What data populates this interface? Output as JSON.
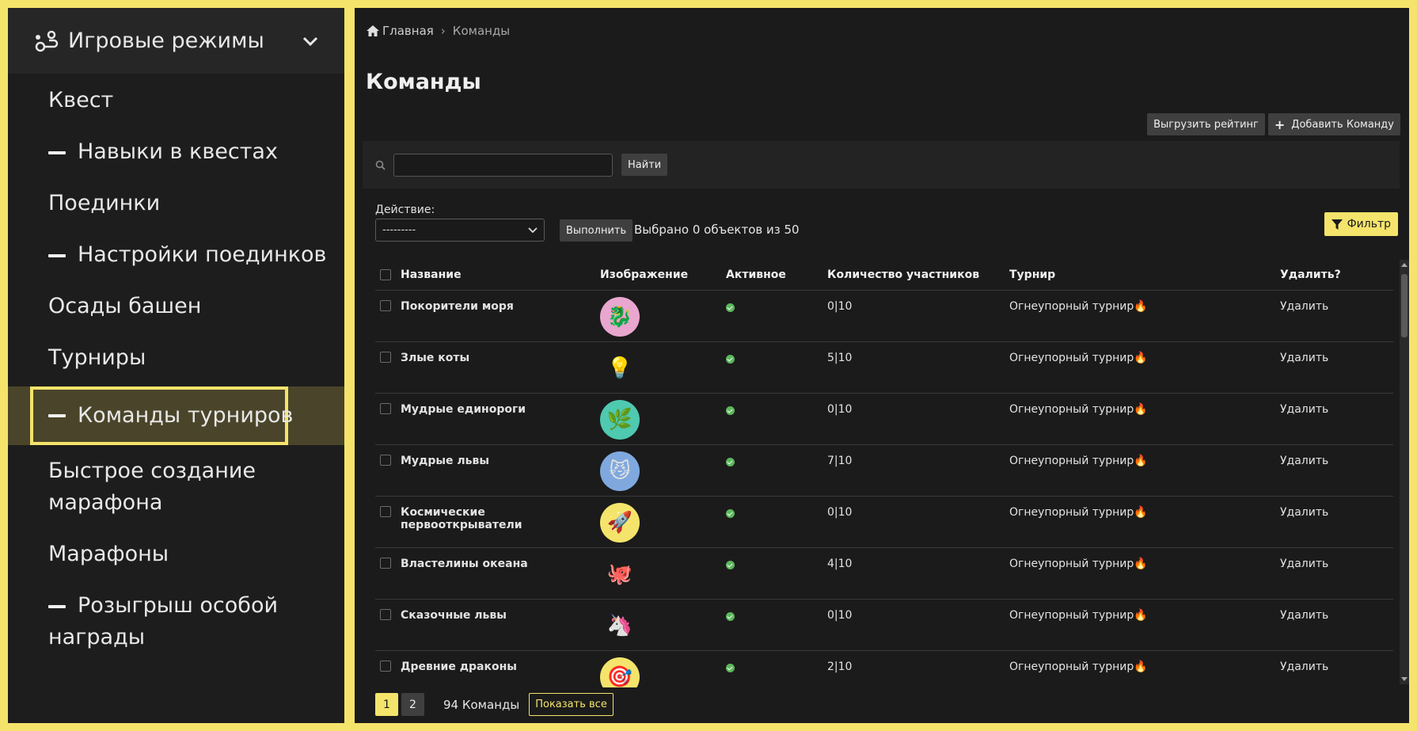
{
  "sidebar": {
    "header_title": "Игровые режимы",
    "items": [
      {
        "label": "Квест",
        "sub": false
      },
      {
        "label": "Навыки в квестах",
        "sub": true
      },
      {
        "label": "Поединки",
        "sub": false
      },
      {
        "label": "Настройки поединков",
        "sub": true
      },
      {
        "label": "Осады башен",
        "sub": false
      },
      {
        "label": "Турниры",
        "sub": false
      },
      {
        "label": "Команды турниров",
        "sub": true,
        "active": true
      },
      {
        "label": "Быстрое создание марафона",
        "label_line1": "Быстрое создание",
        "label_line2": "марафона",
        "sub": false
      },
      {
        "label": "Марафоны",
        "sub": false
      },
      {
        "label": "Розыгрыш особой награды",
        "label_line1": "Розыгрыш особой",
        "label_line2": "награды",
        "sub": true
      }
    ]
  },
  "breadcrumb": {
    "home": "Главная",
    "separator": "›",
    "current": "Команды"
  },
  "page_title": "Команды",
  "toolbar": {
    "export_label": "Выгрузить рейтинг",
    "add_label": "Добавить Команду"
  },
  "search": {
    "value": "",
    "button": "Найти"
  },
  "actions": {
    "label": "Действие:",
    "selected": "---------",
    "run_button": "Выполнить",
    "selected_info": "Выбрано 0 объектов из 50"
  },
  "filter_label": "Фильтр",
  "table": {
    "headers": [
      "Название",
      "Изображение",
      "Активное",
      "Количество участников",
      "Турнир",
      "Удалить?"
    ],
    "rows": [
      {
        "name": "Покорители моря",
        "emoji": "🐉",
        "bg": "#e9a6cf",
        "count": "0|10",
        "tournament": "Огнеупорный турнир🔥",
        "delete": "Удалить"
      },
      {
        "name": "Злые коты",
        "emoji": "💡",
        "bg": "transparent",
        "count": "5|10",
        "tournament": "Огнеупорный турнир🔥",
        "delete": "Удалить"
      },
      {
        "name": "Мудрые единороги",
        "emoji": "🌿",
        "bg": "#4fc9b0",
        "count": "0|10",
        "tournament": "Огнеупорный турнир🔥",
        "delete": "Удалить"
      },
      {
        "name": "Мудрые львы",
        "emoji": "😼",
        "bg": "#7fa9de",
        "count": "7|10",
        "tournament": "Огнеупорный турнир🔥",
        "delete": "Удалить"
      },
      {
        "name": "Космические первооткрыватели",
        "emoji": "🚀",
        "bg": "#f5e46b",
        "count": "0|10",
        "tournament": "Огнеупорный турнир🔥",
        "delete": "Удалить"
      },
      {
        "name": "Властелины океана",
        "emoji": "🐙",
        "bg": "transparent",
        "count": "4|10",
        "tournament": "Огнеупорный турнир🔥",
        "delete": "Удалить"
      },
      {
        "name": "Сказочные львы",
        "emoji": "🦄",
        "bg": "transparent",
        "count": "0|10",
        "tournament": "Огнеупорный турнир🔥",
        "delete": "Удалить"
      },
      {
        "name": "Древние драконы",
        "emoji": "🎯",
        "bg": "#f5e46b",
        "count": "2|10",
        "tournament": "Огнеупорный турнир🔥",
        "delete": "Удалить"
      }
    ]
  },
  "pagination": {
    "pages": [
      "1",
      "2"
    ],
    "current": "1",
    "count_text": "94 Команды",
    "show_all": "Показать все"
  },
  "colors": {
    "accent": "#f5e46b",
    "active_ok": "#5cb85c",
    "sidebar_bg": "#1d1d1d",
    "main_bg": "#1b1b1b"
  }
}
